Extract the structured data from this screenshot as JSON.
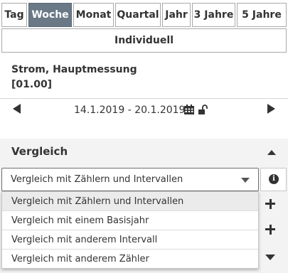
{
  "tabs": [
    {
      "label": "Tag",
      "active": false
    },
    {
      "label": "Woche",
      "active": true
    },
    {
      "label": "Monat",
      "active": false
    },
    {
      "label": "Quartal",
      "active": false
    },
    {
      "label": "Jahr",
      "active": false
    },
    {
      "label": "3 Jahre",
      "active": false
    },
    {
      "label": "5 Jahre",
      "active": false
    }
  ],
  "individuell_label": "Individuell",
  "meter": {
    "name": "Strom, Hauptmessung",
    "code": "[01.00]"
  },
  "date_range": "14.1.2019 - 20.1.2019",
  "icons": {
    "prev": "triangle-left-icon",
    "next": "triangle-right-icon",
    "calendar": "calendar-icon",
    "lock": "unlock-icon",
    "info": "info-circle-icon",
    "add": "plus-icon",
    "collapse": "caret-up-icon",
    "expand": "caret-down-icon"
  },
  "comparison": {
    "title": "Vergleich",
    "selected": "Vergleich mit Zählern und Intervallen",
    "options": [
      "Vergleich mit Zählern und Intervallen",
      "Vergleich mit einem Basisjahr",
      "Vergleich mit anderem Intervall",
      "Vergleich mit anderem Zähler"
    ]
  },
  "colors": {
    "active_tab": "#6b7987",
    "section_bg": "#f3f3f3"
  }
}
